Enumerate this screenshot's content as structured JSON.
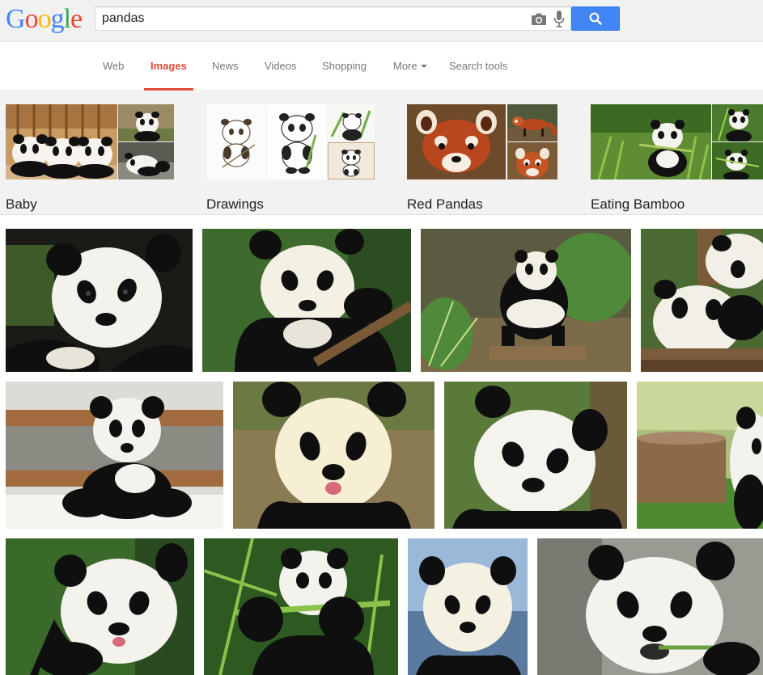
{
  "logo": {
    "letters": [
      "G",
      "o",
      "o",
      "g",
      "l",
      "e"
    ],
    "colors": [
      "#4285f4",
      "#ea4335",
      "#fbbc05",
      "#4285f4",
      "#34a853",
      "#ea4335"
    ]
  },
  "search": {
    "value": "pandas"
  },
  "icons": {
    "camera": "camera-icon",
    "mic": "microphone-icon",
    "search": "magnifier-icon"
  },
  "nav": {
    "items": [
      "Web",
      "Images",
      "News",
      "Videos",
      "Shopping",
      "More",
      "Search tools"
    ],
    "active": "Images",
    "active_color": "#dd4b39"
  },
  "categories": [
    "Baby",
    "Drawings",
    "Red Pandas",
    "Eating Bamboo"
  ],
  "colors": {
    "search_button": "#4285f4",
    "nav_active": "#dd4b39"
  }
}
